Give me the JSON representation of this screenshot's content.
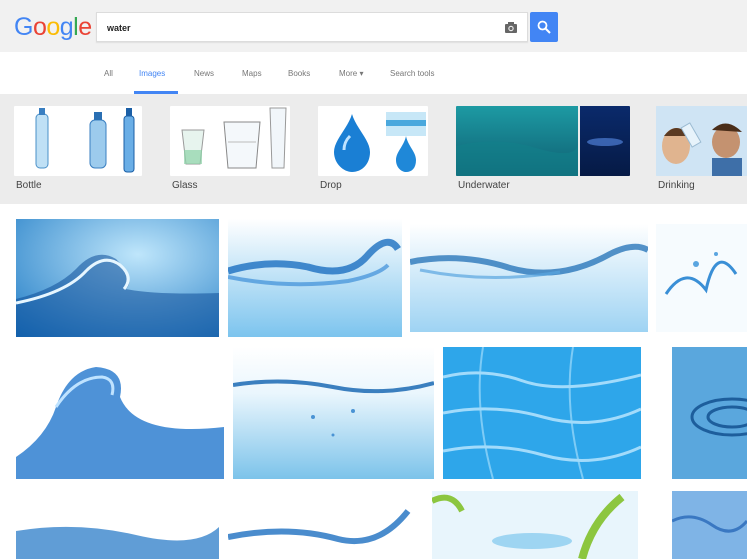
{
  "logo": {
    "letters": [
      "G",
      "o",
      "o",
      "g",
      "l",
      "e"
    ]
  },
  "search": {
    "query": "water",
    "placeholder": ""
  },
  "tabs": [
    {
      "label": "All",
      "active": false
    },
    {
      "label": "Images",
      "active": true
    },
    {
      "label": "News",
      "active": false
    },
    {
      "label": "Maps",
      "active": false
    },
    {
      "label": "Books",
      "active": false
    },
    {
      "label": "More ▾",
      "active": false
    },
    {
      "label": "Search tools",
      "active": false
    }
  ],
  "related": [
    {
      "label": "Bottle"
    },
    {
      "label": "Glass"
    },
    {
      "label": "Drop"
    },
    {
      "label": "Underwater"
    },
    {
      "label": "Drinking"
    }
  ],
  "colors": {
    "accent": "#4285f4",
    "chip_bg": "#ececec"
  },
  "icons": [
    "camera-icon",
    "magnifier-icon"
  ]
}
